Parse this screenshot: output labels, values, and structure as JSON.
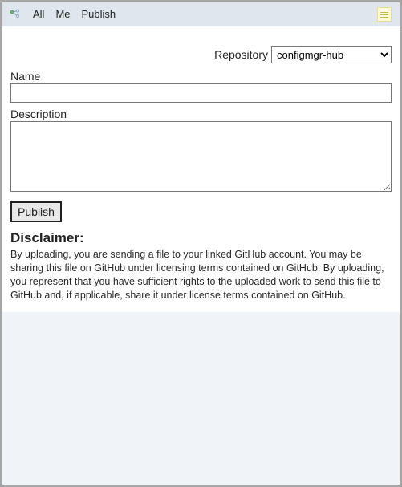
{
  "toolbar": {
    "tabs": {
      "all": "All",
      "me": "Me",
      "publish": "Publish"
    }
  },
  "form": {
    "repository_label": "Repository",
    "repository_value": "configmgr-hub",
    "name_label": "Name",
    "name_value": "",
    "description_label": "Description",
    "description_value": "",
    "publish_button": "Publish"
  },
  "disclaimer": {
    "heading": "Disclaimer:",
    "body": "By uploading, you are sending a file to your linked GitHub account. You may be sharing this file on GitHub under licensing terms contained on GitHub. By uploading, you represent that you have sufficient rights to the uploaded work to send this file to GitHub and, if applicable, share it under license terms contained on GitHub."
  }
}
